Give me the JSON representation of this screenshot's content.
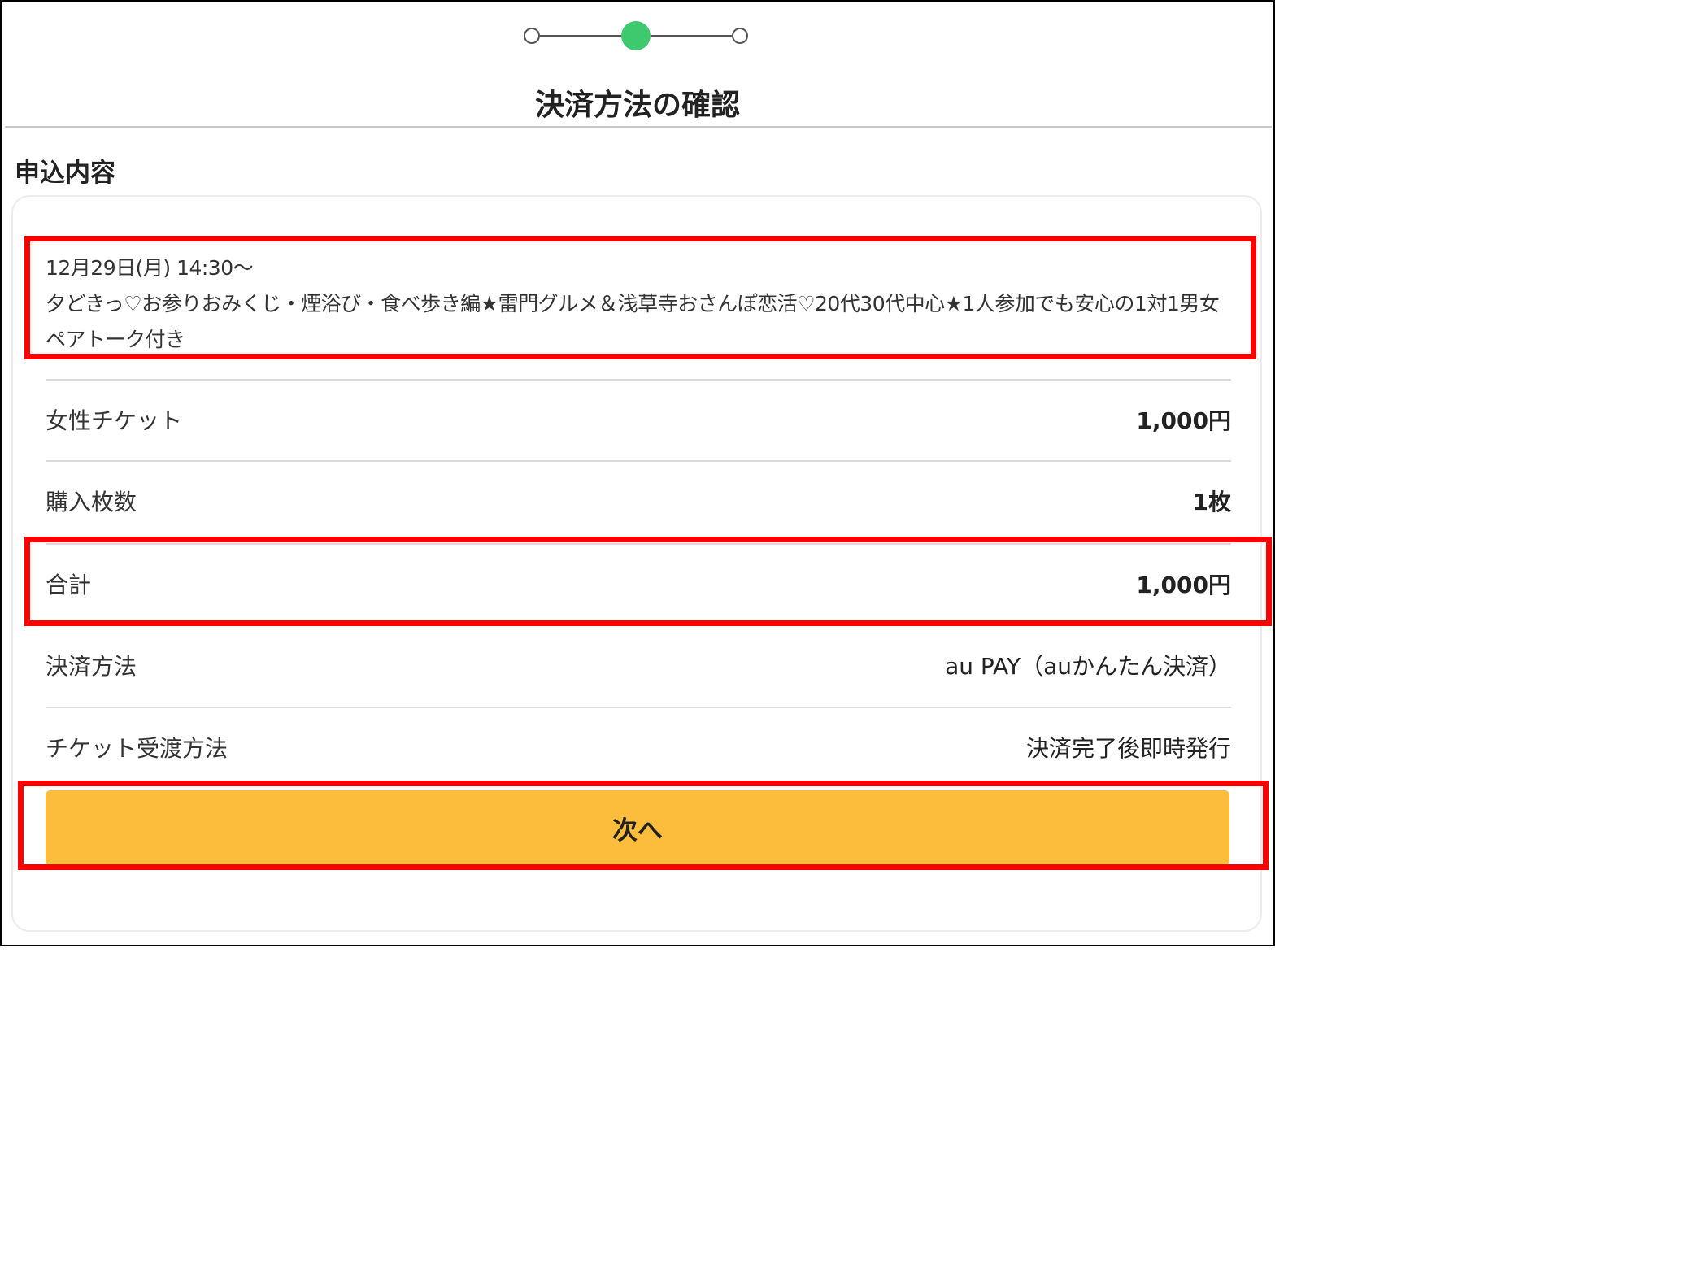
{
  "stepper": {
    "current_step": 2,
    "total_steps": 3,
    "active_color": "#3ec96e"
  },
  "header": {
    "title": "決済方法の確認"
  },
  "section": {
    "label": "申込内容"
  },
  "event": {
    "datetime": "12月29日(月) 14:30〜",
    "name": "夕どきっ♡お参りおみくじ・煙浴び・食べ歩き編★雷門グルメ＆浅草寺おさんぽ恋活♡20代30代中心★1人参加でも安心の1対1男女ペアトーク付き"
  },
  "details": [
    {
      "label": "女性チケット",
      "value": "1,000円"
    },
    {
      "label": "購入枚数",
      "value": "1枚"
    },
    {
      "label": "合計",
      "value": "1,000円"
    },
    {
      "label": "決済方法",
      "value": "au PAY（auかんたん決済）"
    },
    {
      "label": "チケット受渡方法",
      "value": "決済完了後即時発行"
    }
  ],
  "actions": {
    "next_label": "次へ",
    "button_color": "#fcbd3c"
  },
  "highlight": {
    "color": "#ff0000"
  }
}
